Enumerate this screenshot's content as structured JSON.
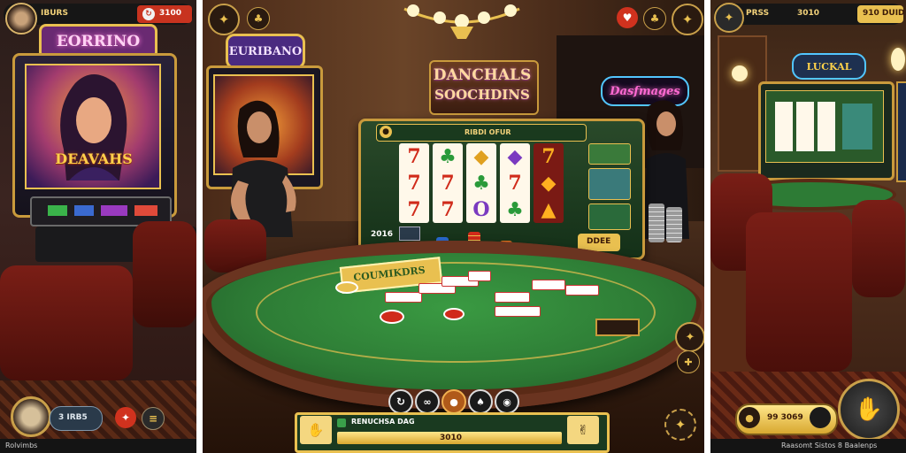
{
  "left": {
    "top_bar": {
      "name": "IBURS",
      "balance": "3100"
    },
    "sign": "EORRINO",
    "machine_title": "DEAVAHS",
    "bottom_label": "Rolvimbs",
    "bottom_pill": "3 IRB5"
  },
  "center": {
    "top_sign": "EURIBANO",
    "room_sign_line1": "DANCHALS",
    "room_sign_line2": "SOOCHDINS",
    "neon_sign": "Dasfmages",
    "machine_header": "RIBDI OFUR",
    "machine_left_label": "2016",
    "machine_side_label": "DDEE",
    "table_label": "COUMIKDRS",
    "reels": [
      [
        "7",
        "7",
        "7"
      ],
      [
        "♣",
        "7",
        "7"
      ],
      [
        "◆",
        "♣",
        "O"
      ],
      [
        "◆",
        "7",
        "♣"
      ],
      [
        "7",
        "◆",
        "▲"
      ]
    ],
    "bottom_bar_text": "RENUCHSA DAG",
    "bottom_bar_value": "3010",
    "footer_icons": [
      "refresh-icon",
      "link-icon",
      "chips-icon",
      "spade-icon",
      "chip-icon"
    ]
  },
  "right": {
    "top_bar": {
      "name": "PRSS",
      "balance": "3010",
      "button": "910 DUID"
    },
    "neon_sign": "LUCKAL",
    "bottom_pill": "99 3069",
    "footer_text": "Raasomt Sistos 8 Baalenps"
  },
  "colors": {
    "gold": "#e9c050",
    "felt": "#2d7b35",
    "red": "#8a1c14",
    "wood": "#5a3620"
  }
}
